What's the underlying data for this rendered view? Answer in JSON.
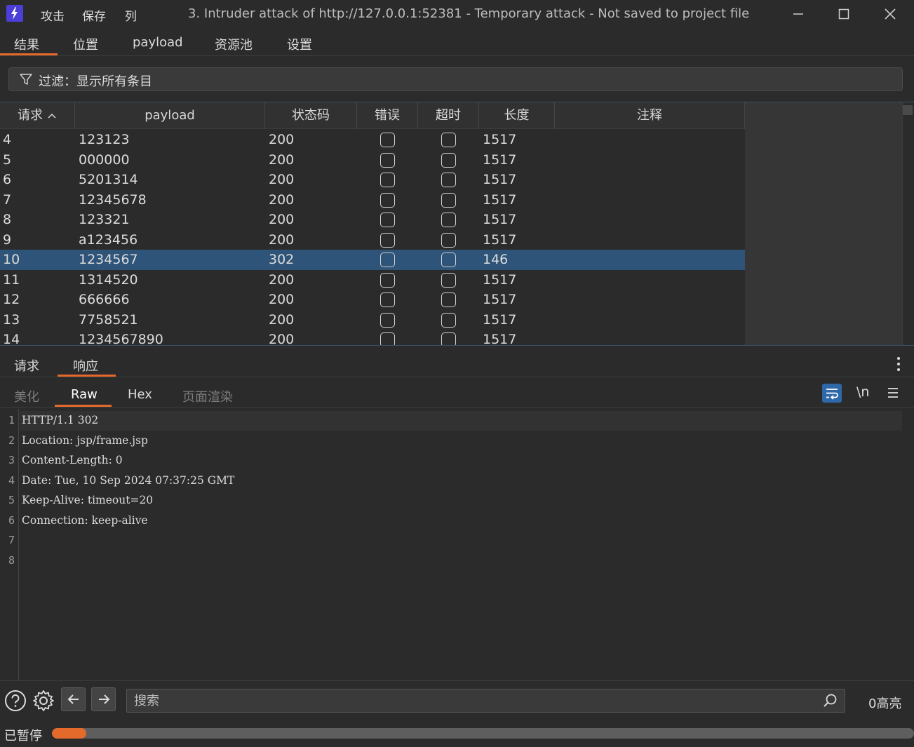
{
  "menu": {
    "attack": "攻击",
    "save": "保存",
    "columns": "列"
  },
  "window": {
    "title": "3. Intruder attack of http://127.0.0.1:52381 - Temporary attack - Not saved to project file"
  },
  "top_tabs": [
    "结果",
    "位置",
    "payload",
    "资源池",
    "设置"
  ],
  "filter": {
    "text": "过滤：显示所有条目"
  },
  "table": {
    "headers": [
      "请求",
      "payload",
      "状态码",
      "错误",
      "超时",
      "长度",
      "注释"
    ],
    "rows": [
      {
        "request": "4",
        "payload": "123123",
        "status": "200",
        "length": "1517"
      },
      {
        "request": "5",
        "payload": "000000",
        "status": "200",
        "length": "1517"
      },
      {
        "request": "6",
        "payload": "5201314",
        "status": "200",
        "length": "1517"
      },
      {
        "request": "7",
        "payload": "12345678",
        "status": "200",
        "length": "1517"
      },
      {
        "request": "8",
        "payload": "123321",
        "status": "200",
        "length": "1517"
      },
      {
        "request": "9",
        "payload": "a123456",
        "status": "200",
        "length": "1517"
      },
      {
        "request": "10",
        "payload": "1234567",
        "status": "302",
        "length": "146",
        "selected": true
      },
      {
        "request": "11",
        "payload": "1314520",
        "status": "200",
        "length": "1517"
      },
      {
        "request": "12",
        "payload": "666666",
        "status": "200",
        "length": "1517"
      },
      {
        "request": "13",
        "payload": "7758521",
        "status": "200",
        "length": "1517"
      },
      {
        "request": "14",
        "payload": "1234567890",
        "status": "200",
        "length": "1517"
      }
    ]
  },
  "rr_tabs": {
    "request": "请求",
    "response": "响应"
  },
  "view_tabs": {
    "pretty": "美化",
    "raw": "Raw",
    "hex": "Hex",
    "render": "页面渲染",
    "newline": "\\n"
  },
  "editor": {
    "lines": [
      "HTTP/1.1 302",
      "Location: jsp/frame.jsp",
      "Content-Length: 0",
      "Date: Tue, 10 Sep 2024 07:37:25 GMT",
      "Keep-Alive: timeout=20",
      "Connection: keep-alive",
      "",
      ""
    ]
  },
  "search": {
    "placeholder": "搜索",
    "highlights": "0高亮"
  },
  "status": {
    "text": "已暂停",
    "progress": 0.04
  },
  "colors": {
    "accent": "#e46a2b",
    "selected_row": "#2f5479",
    "logo": "#4b3fd8"
  },
  "icons": [
    "burp-logo-icon",
    "minimize-icon",
    "maximize-icon",
    "close-icon",
    "filter-icon",
    "sort-ascending-icon",
    "kebab-menu-icon",
    "word-wrap-icon",
    "hamburger-menu-icon",
    "help-icon",
    "gear-icon",
    "arrow-left-icon",
    "arrow-right-icon",
    "search-icon"
  ]
}
